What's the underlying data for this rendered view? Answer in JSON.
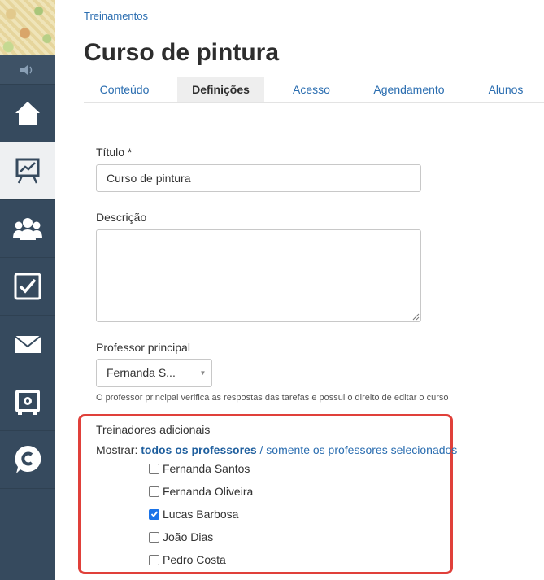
{
  "sidebar": {
    "items": [
      {
        "name": "home",
        "icon": "home-icon",
        "active": false
      },
      {
        "name": "trainings",
        "icon": "presentation-chart-icon",
        "active": true
      },
      {
        "name": "users",
        "icon": "users-group-icon",
        "active": false
      },
      {
        "name": "tasks",
        "icon": "checkbox-icon",
        "active": false
      },
      {
        "name": "messages",
        "icon": "envelope-icon",
        "active": false
      },
      {
        "name": "vault",
        "icon": "safe-icon",
        "active": false
      },
      {
        "name": "chat",
        "icon": "c-bubble-icon",
        "active": false
      }
    ]
  },
  "breadcrumb": "Treinamentos",
  "page_title": "Curso de pintura",
  "tabs": [
    {
      "label": "Conteúdo",
      "active": false
    },
    {
      "label": "Definições",
      "active": true
    },
    {
      "label": "Acesso",
      "active": false
    },
    {
      "label": "Agendamento",
      "active": false
    },
    {
      "label": "Alunos",
      "active": false
    }
  ],
  "form": {
    "title_label": "Título *",
    "title_value": "Curso de pintura",
    "description_label": "Descrição",
    "description_value": "",
    "professor_label": "Professor principal",
    "professor_value": "Fernanda S...",
    "professor_help": "O professor principal verifica as respostas das tarefas e possui o direito de editar o curso"
  },
  "trainers": {
    "title": "Treinadores adicionais",
    "filter_prefix": "Mostrar:",
    "filter_all": "todos os professores",
    "filter_separator": "/",
    "filter_selected": "somente os professores selecionados",
    "list": [
      {
        "name": "Fernanda Santos",
        "checked": false
      },
      {
        "name": "Fernanda Oliveira",
        "checked": false
      },
      {
        "name": "Lucas Barbosa",
        "checked": true
      },
      {
        "name": "João Dias",
        "checked": false
      },
      {
        "name": "Pedro Costa",
        "checked": false
      }
    ]
  },
  "colors": {
    "sidebar": "#364a5e",
    "link": "#2a6db0",
    "highlight": "#e0403a",
    "checkbox_checked": "#1a73e8"
  }
}
